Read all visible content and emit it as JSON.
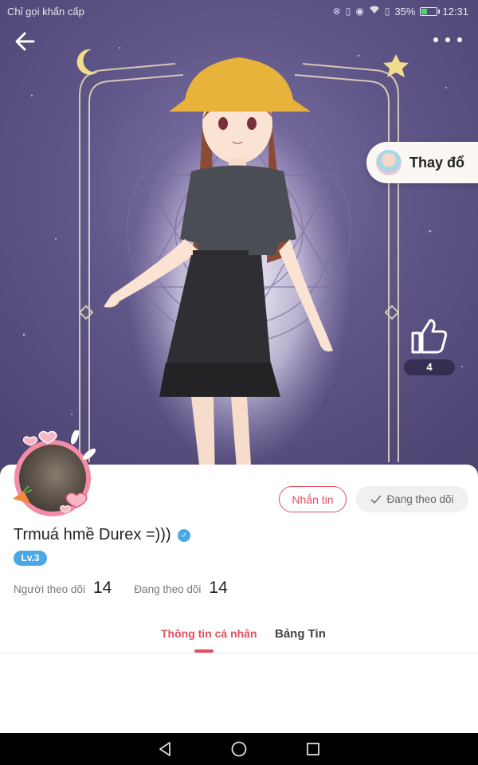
{
  "status_bar": {
    "carrier_text": "Chỉ gọi khẩn cấp",
    "battery_percent": "35%",
    "battery_level": 0.35,
    "time": "12:31",
    "icons": [
      "nfc-icon",
      "vibrate-icon",
      "eye-icon",
      "wifi-icon",
      "sim-icon",
      "battery-icon"
    ]
  },
  "header": {
    "back_icon": "arrow-left-icon",
    "more_icon": "more-horizontal-icon"
  },
  "character": {
    "change_outfit_label": "Thay đổ",
    "like_count": "4"
  },
  "profile": {
    "username": "Trmuá hmề Durex =)))",
    "gender_symbol": "♂",
    "level": "Lv.3",
    "message_button": "Nhắn tin",
    "following_button": "Đang theo dõi",
    "followers_label": "Người theo dõi",
    "followers_count": "14",
    "following_label": "Đang theo dõi",
    "following_count": "14"
  },
  "tabs": [
    {
      "label": "Thông tin cá nhân",
      "active": true
    },
    {
      "label": "Bảng Tin",
      "active": false
    }
  ],
  "colors": {
    "accent": "#e0505f",
    "level_blue": "#4aa8e8",
    "hero_purple": "#5f5688"
  }
}
